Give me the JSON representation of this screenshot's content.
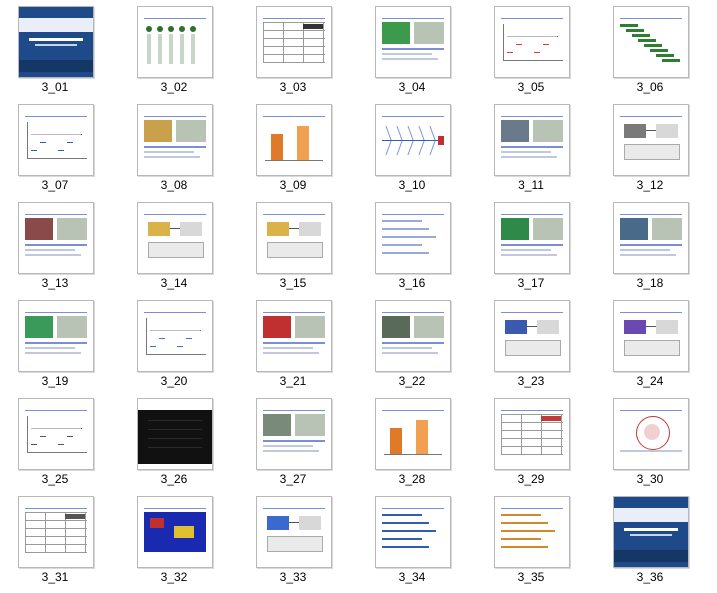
{
  "thumbnails": [
    {
      "label": "3_01",
      "title": "",
      "style": "cover",
      "accent": "#1e4a8a"
    },
    {
      "label": "3_02",
      "title": "",
      "style": "list",
      "accent": "#2f6f2f"
    },
    {
      "label": "3_03",
      "title": "",
      "style": "table",
      "accent": "#333333"
    },
    {
      "label": "3_04",
      "title": "",
      "style": "photo",
      "accent": "#3c9a4c"
    },
    {
      "label": "3_05",
      "title": "",
      "style": "chart",
      "accent": "#d04040"
    },
    {
      "label": "3_06",
      "title": "",
      "style": "gantt",
      "accent": "#2e7d32"
    },
    {
      "label": "3_07",
      "title": "",
      "style": "chart",
      "accent": "#2f5fb0"
    },
    {
      "label": "3_08",
      "title": "",
      "style": "photo",
      "accent": "#c9a14a"
    },
    {
      "label": "3_09",
      "title": "",
      "style": "bars",
      "accent": "#e07a2a"
    },
    {
      "label": "3_10",
      "title": "",
      "style": "fishbone",
      "accent": "#2f5fb0"
    },
    {
      "label": "3_11",
      "title": "",
      "style": "photo",
      "accent": "#6a7a8a"
    },
    {
      "label": "3_12",
      "title": "",
      "style": "diagram",
      "accent": "#7a7a7a"
    },
    {
      "label": "3_13",
      "title": "",
      "style": "photo",
      "accent": "#8a4a4a"
    },
    {
      "label": "3_14",
      "title": "",
      "style": "diagram",
      "accent": "#d9b24a"
    },
    {
      "label": "3_15",
      "title": "",
      "style": "diagram",
      "accent": "#d9b24a"
    },
    {
      "label": "3_16",
      "title": "",
      "style": "text",
      "accent": "#9aa8d8"
    },
    {
      "label": "3_17",
      "title": "",
      "style": "photo",
      "accent": "#2f8a4a"
    },
    {
      "label": "3_18",
      "title": "",
      "style": "photo",
      "accent": "#4a6a8a"
    },
    {
      "label": "3_19",
      "title": "",
      "style": "photo",
      "accent": "#3a9a5a"
    },
    {
      "label": "3_20",
      "title": "",
      "style": "chart",
      "accent": "#3a7ad0"
    },
    {
      "label": "3_21",
      "title": "",
      "style": "photo",
      "accent": "#c03030"
    },
    {
      "label": "3_22",
      "title": "",
      "style": "photo",
      "accent": "#5a6a5a"
    },
    {
      "label": "3_23",
      "title": "",
      "style": "diagram",
      "accent": "#3a5ab0"
    },
    {
      "label": "3_24",
      "title": "",
      "style": "diagram",
      "accent": "#6a4ab0"
    },
    {
      "label": "3_25",
      "title": "",
      "style": "chart",
      "accent": "#555555"
    },
    {
      "label": "3_26",
      "title": "",
      "style": "dark",
      "accent": "#111111"
    },
    {
      "label": "3_27",
      "title": "",
      "style": "photo",
      "accent": "#7a8a7a"
    },
    {
      "label": "3_28",
      "title": "",
      "style": "bars",
      "accent": "#e07a2a"
    },
    {
      "label": "3_29",
      "title": "",
      "style": "table",
      "accent": "#c03a3a"
    },
    {
      "label": "3_30",
      "title": "",
      "style": "radar",
      "accent": "#c03a3a"
    },
    {
      "label": "3_31",
      "title": "",
      "style": "table",
      "accent": "#555555"
    },
    {
      "label": "3_32",
      "title": "",
      "style": "pcb",
      "accent": "#1a2ab0"
    },
    {
      "label": "3_33",
      "title": "",
      "style": "diagram",
      "accent": "#3a6ad0"
    },
    {
      "label": "3_34",
      "title": "",
      "style": "text",
      "accent": "#2f5fb0"
    },
    {
      "label": "3_35",
      "title": "",
      "style": "text",
      "accent": "#d08a2a"
    },
    {
      "label": "3_36",
      "title": "",
      "style": "cover",
      "accent": "#1e4a8a"
    }
  ],
  "colors": {
    "title_blue": "#1f3fb0",
    "background": "#ffffff",
    "caption": "#000000"
  }
}
